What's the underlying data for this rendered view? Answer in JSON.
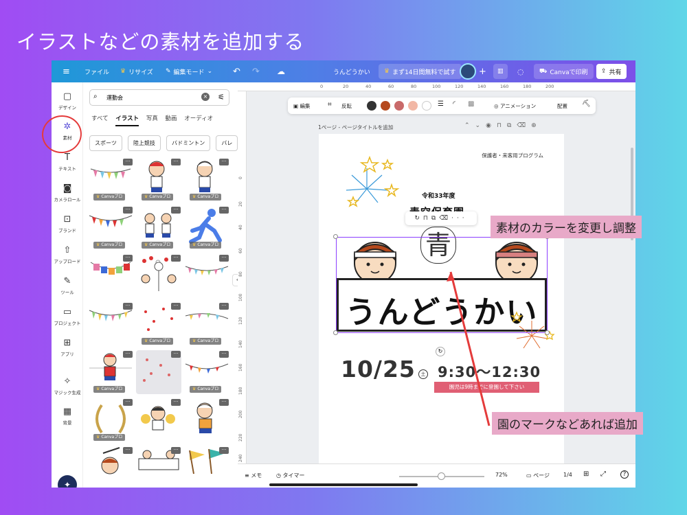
{
  "slide": {
    "title": "イラストなどの素材を追加する"
  },
  "topbar": {
    "menu_icon": "hamburger-icon",
    "file": "ファイル",
    "resize": "リサイズ",
    "edit_mode": "編集モード",
    "doc_title": "うんどうかい",
    "trial": "まず14日間無料で試す",
    "print": "Canvaで印刷",
    "share": "共有"
  },
  "rail": {
    "items": [
      {
        "label": "デザイン",
        "icon": "design-icon"
      },
      {
        "label": "素材",
        "icon": "elements-icon"
      },
      {
        "label": "テキスト",
        "icon": "text-icon"
      },
      {
        "label": "カメラロール",
        "icon": "camera-icon"
      },
      {
        "label": "ブランド",
        "icon": "brand-icon"
      },
      {
        "label": "アップロード",
        "icon": "upload-icon"
      },
      {
        "label": "ツール",
        "icon": "tool-icon"
      },
      {
        "label": "プロジェクト",
        "icon": "folder-icon"
      },
      {
        "label": "アプリ",
        "icon": "apps-icon"
      },
      {
        "label": "マジック生成",
        "icon": "magic-icon"
      },
      {
        "label": "背景",
        "icon": "background-icon"
      }
    ]
  },
  "panel": {
    "search_value": "運動会",
    "tabs": [
      "すべて",
      "イラスト",
      "写真",
      "動画",
      "オーディオ"
    ],
    "active_tab": "イラスト",
    "chips": [
      "スポーツ",
      "陸上競技",
      "バドミントン",
      "バレ"
    ],
    "pro_badge": "Canvaプロ"
  },
  "ruler": {
    "top": [
      "0",
      "20",
      "40",
      "60",
      "80",
      "100",
      "120",
      "140",
      "160",
      "180",
      "200"
    ],
    "left": [
      "0",
      "20",
      "40",
      "60",
      "80",
      "100",
      "120",
      "140",
      "160",
      "180",
      "200",
      "220",
      "240",
      "260",
      "280"
    ]
  },
  "toolbar": {
    "edit": "編集",
    "flip": "反転",
    "animation": "アニメーション",
    "position": "配置",
    "colors": [
      "#333333",
      "#b5491d",
      "#c96a6a",
      "#f2b7a5",
      "#ffffff"
    ]
  },
  "page_label": "1ページ - ページタイトルを追加",
  "canvas": {
    "program_label": "保護者・来客用プログラム",
    "reiwa": "令和33年度",
    "kinder_partial": "青空保育園",
    "banner": "うんどうかい",
    "mark": "青",
    "date": "10/25",
    "dow": "土",
    "time": "9:30〜12:30",
    "notice": "園児は9時までに登園して下さい"
  },
  "bottombar": {
    "memo": "メモ",
    "timer": "タイマー",
    "zoom": "72%",
    "pages": "ページ",
    "page_count": "1/4"
  },
  "annotations": {
    "color": "素材のカラーを変更し調整",
    "mark": "園のマークなどあれば追加"
  }
}
